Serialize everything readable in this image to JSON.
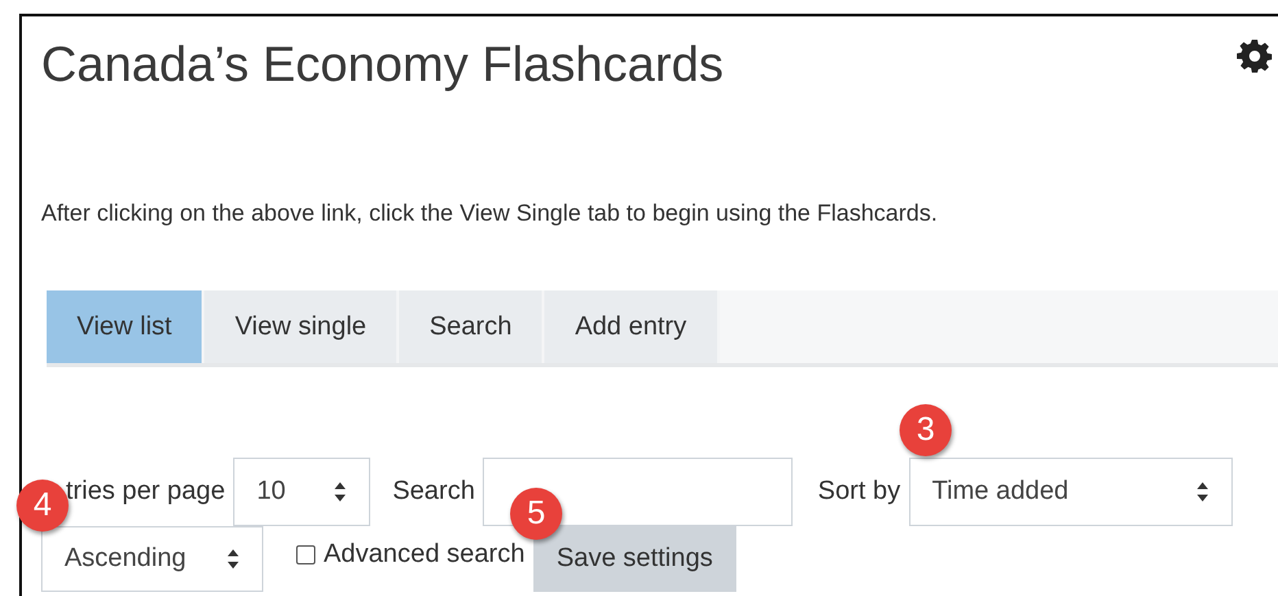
{
  "title": "Canada’s Economy Flashcards",
  "intro": "After clicking on the above link, click the View Single tab to begin using the Flashcards.",
  "tabs": [
    {
      "label": "View list",
      "selected": true
    },
    {
      "label": "View single",
      "selected": false
    },
    {
      "label": "Search",
      "selected": false
    },
    {
      "label": "Add entry",
      "selected": false
    }
  ],
  "form": {
    "entries_label": "tries per page",
    "entries_value": "10",
    "search_label": "Search",
    "sort_label": "Sort by",
    "sort_value": "Time added",
    "order_value": "Ascending",
    "advanced_search": {
      "label": "Advanced search",
      "checked": false
    },
    "save_button": "Save settings"
  },
  "callouts": [
    {
      "number": "3"
    },
    {
      "number": "4"
    },
    {
      "number": "5"
    }
  ]
}
